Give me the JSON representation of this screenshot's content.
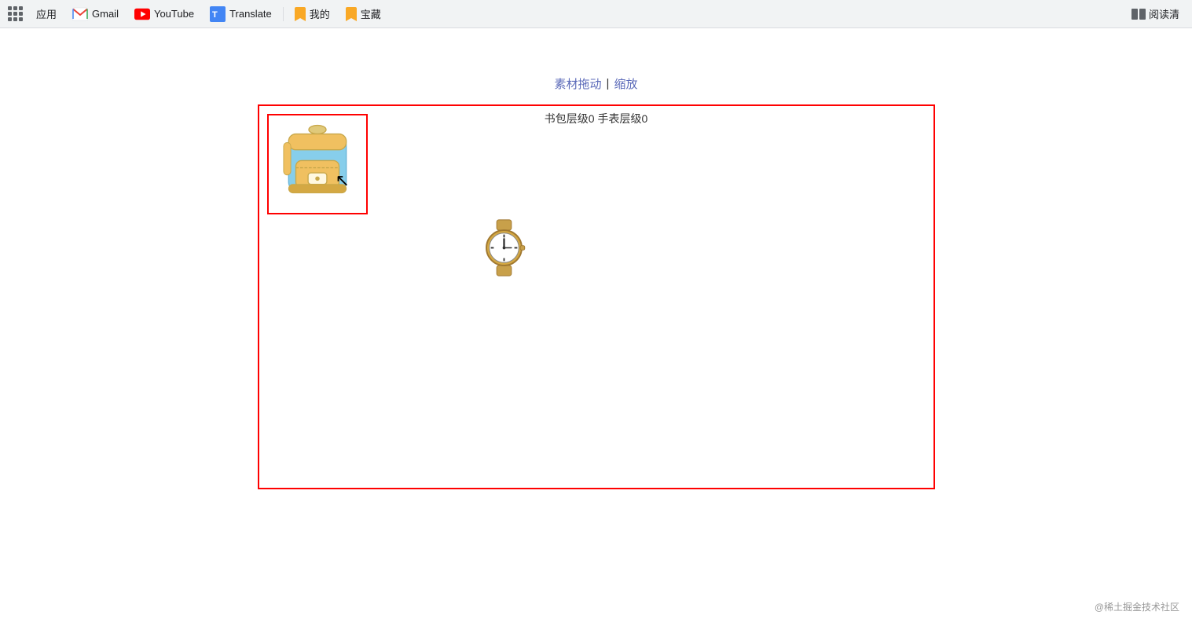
{
  "toolbar": {
    "apps_label": "应用",
    "gmail_label": "Gmail",
    "youtube_label": "YouTube",
    "translate_label": "Translate",
    "bookmark1_label": "我的",
    "bookmark2_label": "宝藏",
    "reading_mode_label": "阅读清"
  },
  "controls": {
    "drag_label": "素材拖动",
    "separator": "|",
    "zoom_label": "缩放"
  },
  "canvas": {
    "status_text": "书包层级0 手表层级0"
  },
  "watermark": {
    "text": "@稀土掘金技术社区"
  }
}
